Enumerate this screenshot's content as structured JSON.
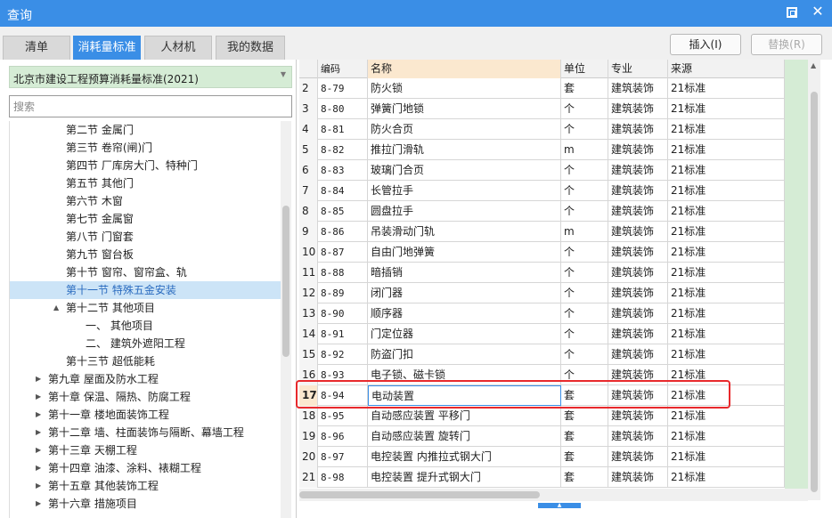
{
  "window": {
    "title": "查询",
    "close_glyph": "✕"
  },
  "tabs": [
    {
      "label": "清单",
      "active": false
    },
    {
      "label": "消耗量标准",
      "active": true
    },
    {
      "label": "人材机",
      "active": false
    },
    {
      "label": "我的数据",
      "active": false
    }
  ],
  "toolbar": {
    "insert_label": "插入(I)",
    "replace_label": "替换(R)"
  },
  "left": {
    "standard_selected": "北京市建设工程预算消耗量标准(2021)",
    "search_placeholder": "搜索",
    "tree": [
      {
        "label": "第二节 金属门",
        "toggle": ""
      },
      {
        "label": "第三节 卷帘(闸)门",
        "toggle": ""
      },
      {
        "label": "第四节 厂库房大门、特种门",
        "toggle": ""
      },
      {
        "label": "第五节 其他门",
        "toggle": ""
      },
      {
        "label": "第六节 木窗",
        "toggle": ""
      },
      {
        "label": "第七节 金属窗",
        "toggle": ""
      },
      {
        "label": "第八节 门窗套",
        "toggle": ""
      },
      {
        "label": "第九节 窗台板",
        "toggle": ""
      },
      {
        "label": "第十节 窗帘、窗帘盒、轨",
        "toggle": ""
      },
      {
        "label": "第十一节 特殊五金安装",
        "toggle": "",
        "selected": true
      },
      {
        "label": "第十二节 其他项目",
        "toggle": "▲"
      },
      {
        "label": "一、 其他项目",
        "toggle": ""
      },
      {
        "label": "二、 建筑外遮阳工程",
        "toggle": ""
      },
      {
        "label": "第十三节 超低能耗",
        "toggle": ""
      },
      {
        "label": "第九章 屋面及防水工程",
        "toggle": "▶"
      },
      {
        "label": "第十章 保温、隔热、防腐工程",
        "toggle": "▶"
      },
      {
        "label": "第十一章 楼地面装饰工程",
        "toggle": "▶"
      },
      {
        "label": "第十二章 墙、柱面装饰与隔断、幕墙工程",
        "toggle": "▶"
      },
      {
        "label": "第十三章 天棚工程",
        "toggle": "▶"
      },
      {
        "label": "第十四章 油漆、涂料、裱糊工程",
        "toggle": "▶"
      },
      {
        "label": "第十五章 其他装饰工程",
        "toggle": "▶"
      },
      {
        "label": "第十六章 措施项目",
        "toggle": "▶"
      }
    ]
  },
  "table": {
    "headers": {
      "code": "编码",
      "name": "名称",
      "unit": "单位",
      "spec": "专业",
      "source": "来源"
    },
    "current_row": "17",
    "rows": [
      {
        "rn": "2",
        "code": "8-79",
        "name": "防火锁",
        "unit": "套",
        "spec": "建筑装饰",
        "source": "21标准"
      },
      {
        "rn": "3",
        "code": "8-80",
        "name": "弹簧门地锁",
        "unit": "个",
        "spec": "建筑装饰",
        "source": "21标准"
      },
      {
        "rn": "4",
        "code": "8-81",
        "name": "防火合页",
        "unit": "个",
        "spec": "建筑装饰",
        "source": "21标准"
      },
      {
        "rn": "5",
        "code": "8-82",
        "name": "推拉门滑轨",
        "unit": "m",
        "spec": "建筑装饰",
        "source": "21标准"
      },
      {
        "rn": "6",
        "code": "8-83",
        "name": "玻璃门合页",
        "unit": "个",
        "spec": "建筑装饰",
        "source": "21标准"
      },
      {
        "rn": "7",
        "code": "8-84",
        "name": "长管拉手",
        "unit": "个",
        "spec": "建筑装饰",
        "source": "21标准"
      },
      {
        "rn": "8",
        "code": "8-85",
        "name": "圆盘拉手",
        "unit": "个",
        "spec": "建筑装饰",
        "source": "21标准"
      },
      {
        "rn": "9",
        "code": "8-86",
        "name": "吊装滑动门轨",
        "unit": "m",
        "spec": "建筑装饰",
        "source": "21标准"
      },
      {
        "rn": "10",
        "code": "8-87",
        "name": "自由门地弹簧",
        "unit": "个",
        "spec": "建筑装饰",
        "source": "21标准"
      },
      {
        "rn": "11",
        "code": "8-88",
        "name": "暗插销",
        "unit": "个",
        "spec": "建筑装饰",
        "source": "21标准"
      },
      {
        "rn": "12",
        "code": "8-89",
        "name": "闭门器",
        "unit": "个",
        "spec": "建筑装饰",
        "source": "21标准"
      },
      {
        "rn": "13",
        "code": "8-90",
        "name": "顺序器",
        "unit": "个",
        "spec": "建筑装饰",
        "source": "21标准"
      },
      {
        "rn": "14",
        "code": "8-91",
        "name": "门定位器",
        "unit": "个",
        "spec": "建筑装饰",
        "source": "21标准"
      },
      {
        "rn": "15",
        "code": "8-92",
        "name": "防盗门扣",
        "unit": "个",
        "spec": "建筑装饰",
        "source": "21标准"
      },
      {
        "rn": "16",
        "code": "8-93",
        "name": "电子锁、磁卡锁",
        "unit": "个",
        "spec": "建筑装饰",
        "source": "21标准"
      },
      {
        "rn": "17",
        "code": "8-94",
        "name": "电动装置",
        "unit": "套",
        "spec": "建筑装饰",
        "source": "21标准"
      },
      {
        "rn": "18",
        "code": "8-95",
        "name": "自动感应装置 平移门",
        "unit": "套",
        "spec": "建筑装饰",
        "source": "21标准"
      },
      {
        "rn": "19",
        "code": "8-96",
        "name": "自动感应装置 旋转门",
        "unit": "套",
        "spec": "建筑装饰",
        "source": "21标准"
      },
      {
        "rn": "20",
        "code": "8-97",
        "name": "电控装置 内推拉式钢大门",
        "unit": "套",
        "spec": "建筑装饰",
        "source": "21标准"
      },
      {
        "rn": "21",
        "code": "8-98",
        "name": "电控装置 提升式钢大门",
        "unit": "套",
        "spec": "建筑装饰",
        "source": "21标准"
      }
    ]
  },
  "colors": {
    "accent": "#3a8ee6",
    "highlight_border": "#e8292c",
    "panel_green": "#d5ecd5",
    "selected_tree": "#cce4f7"
  }
}
